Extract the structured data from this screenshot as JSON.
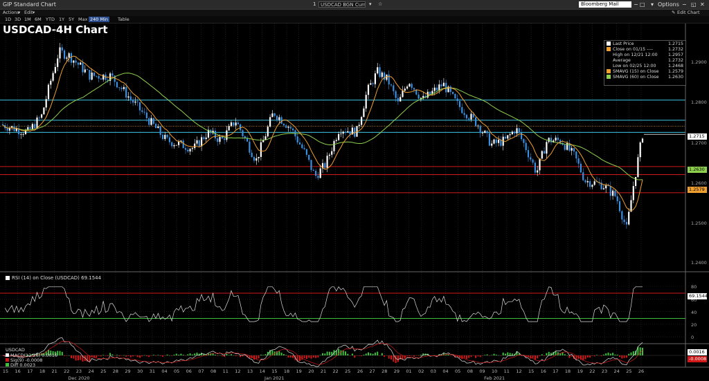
{
  "window": {
    "title": "GIP Standard Chart",
    "security_num": "1",
    "security": "USDCAD BGN Curncy",
    "mail": "Bloomberg Mail",
    "options": "Options"
  },
  "toolbar": {
    "actions": "Actions",
    "edit": "Edit",
    "edit_chart": "Edit Chart",
    "timeframes": [
      "1D",
      "3D",
      "1M",
      "6M",
      "YTD",
      "1Y",
      "5Y",
      "Max",
      "240 Min",
      "Table"
    ],
    "active_timeframe": "240 Min"
  },
  "chart": {
    "title": "USDCAD-4H Chart",
    "legend": [
      {
        "label": "Last Price",
        "value": "1.2715",
        "color": "#ffffff"
      },
      {
        "label": "Close on 01/15 ----",
        "value": "1.2732",
        "color": "#f0a030"
      },
      {
        "label": "High on 12/21 12:00",
        "value": "1.2957",
        "color": ""
      },
      {
        "label": "Average",
        "value": "1.2732",
        "color": ""
      },
      {
        "label": "Low on 02/25 12:00",
        "value": "1.2468",
        "color": ""
      },
      {
        "label": "SMAVG (15) on Close",
        "value": "1.2579",
        "color": "#f0a030"
      },
      {
        "label": "SMAVG (60) on Close",
        "value": "1.2630",
        "color": "#8fd14f"
      }
    ],
    "y_ticks": [
      "1.2900",
      "1.2800",
      "1.2700",
      "1.2600",
      "1.2500",
      "1.2400"
    ],
    "flags": {
      "last": "1.2715",
      "sma60": "1.2630",
      "sma15": "1.2579"
    }
  },
  "rsi": {
    "label": "RSI (14)  on Close (USDCAD) 69.1544",
    "value": "69.1544",
    "ticks": [
      "80",
      "60",
      "40",
      "20",
      "0"
    ]
  },
  "macd": {
    "title": "USDCAD",
    "lines": [
      "MACD(12,26) 0.0016",
      "Sig(9)       -0.0008",
      "Diff         0.0023"
    ],
    "flag1": "0.0016",
    "flag2": "-0.0008"
  },
  "xaxis": {
    "days": [
      "15",
      "16",
      "17",
      "18",
      "21",
      "22",
      "23",
      "24",
      "25",
      "28",
      "29",
      "30",
      "31",
      "04",
      "05",
      "06",
      "07",
      "08",
      "11",
      "12",
      "13",
      "14",
      "15",
      "18",
      "19",
      "20",
      "21",
      "22",
      "25",
      "26",
      "27",
      "28",
      "29",
      "01",
      "02",
      "03",
      "04",
      "05",
      "08",
      "09",
      "10",
      "11",
      "12",
      "15",
      "16",
      "17",
      "18",
      "19",
      "22",
      "23",
      "24",
      "25",
      "26"
    ],
    "months": [
      {
        "label": "Dec 2020",
        "day_index": 6
      },
      {
        "label": "Jan 2021",
        "day_index": 22
      },
      {
        "label": "Feb 2021",
        "day_index": 40
      }
    ]
  },
  "colors": {
    "red_line": "#d01818",
    "cyan_line": "#40c8e8",
    "sma15": "#f0a030",
    "sma60": "#8fd14f",
    "up": "#ffffff",
    "down": "#3b8fe0"
  }
}
